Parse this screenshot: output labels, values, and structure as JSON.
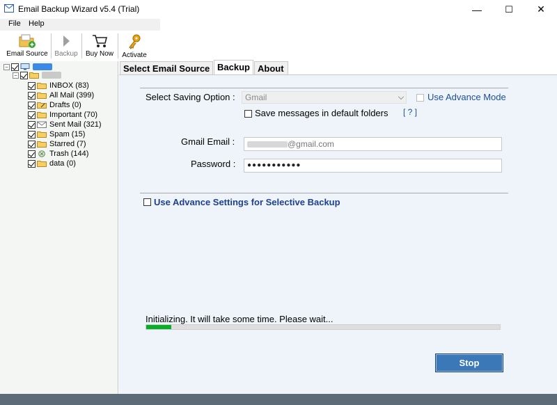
{
  "window": {
    "title": "Email Backup Wizard v5.4 (Trial)",
    "controls": {
      "minimize": "—",
      "maximize": "☐",
      "close": "✕"
    }
  },
  "menu": {
    "file": "File",
    "help": "Help"
  },
  "toolbar": {
    "email_source": "Email Source",
    "backup": "Backup",
    "buy_now": "Buy Now",
    "activate": "Activate"
  },
  "tree": {
    "folders": [
      {
        "label": "INBOX (83)",
        "icon": "folder-icon"
      },
      {
        "label": "All Mail (399)",
        "icon": "folder-icon"
      },
      {
        "label": "Drafts (0)",
        "icon": "drafts-icon"
      },
      {
        "label": "Important (70)",
        "icon": "folder-icon"
      },
      {
        "label": "Sent Mail (321)",
        "icon": "sent-icon"
      },
      {
        "label": "Spam (15)",
        "icon": "folder-icon"
      },
      {
        "label": "Starred (7)",
        "icon": "folder-icon"
      },
      {
        "label": "Trash (144)",
        "icon": "trash-icon"
      },
      {
        "label": "data (0)",
        "icon": "folder-icon"
      }
    ]
  },
  "tabs": {
    "select_source": "Select Email Source",
    "backup": "Backup",
    "about": "About"
  },
  "form": {
    "saving_option_label": "Select Saving Option :",
    "saving_option_value": "Gmail",
    "advance_mode_label": "Use Advance Mode",
    "save_default_label": "Save messages in default folders",
    "help_link": "[ ? ]",
    "gmail_email_label": "Gmail Email :",
    "gmail_email_value": "@gmail.com",
    "password_label": "Password :",
    "password_value": "●●●●●●●●●●●",
    "advance_settings_label": "Use Advance Settings for Selective Backup"
  },
  "progress": {
    "status": "Initializing. It will take some time. Please wait...",
    "percent": 7
  },
  "buttons": {
    "stop": "Stop"
  },
  "colors": {
    "panel_bg": "#eef4f9",
    "left_bg": "#f4f6f3",
    "accent": "#3b78b7",
    "progress_fill": "#06b025",
    "link": "#1a4f9a",
    "status_bar": "#5d6a78"
  }
}
